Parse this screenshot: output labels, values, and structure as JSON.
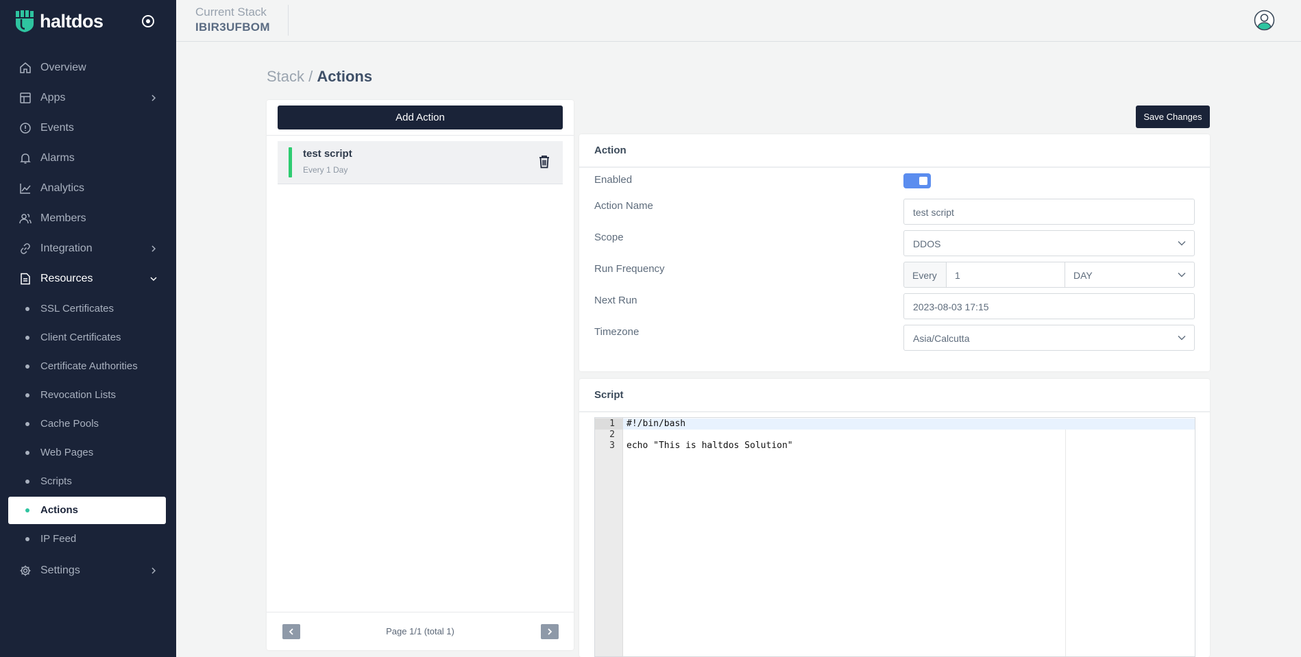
{
  "brand": {
    "name": "haltdos"
  },
  "sidebar": {
    "items": [
      {
        "label": "Overview",
        "icon": "home-icon"
      },
      {
        "label": "Apps",
        "icon": "layout-icon",
        "has_children": true
      },
      {
        "label": "Events",
        "icon": "alert-circle-icon"
      },
      {
        "label": "Alarms",
        "icon": "bell-icon"
      },
      {
        "label": "Analytics",
        "icon": "chart-line-icon"
      },
      {
        "label": "Members",
        "icon": "users-icon"
      },
      {
        "label": "Integration",
        "icon": "link-icon",
        "has_children": true
      },
      {
        "label": "Resources",
        "icon": "file-text-icon",
        "expanded": true
      },
      {
        "label": "Settings",
        "icon": "gear-icon",
        "has_children": true
      }
    ],
    "resources": [
      {
        "label": "SSL Certificates"
      },
      {
        "label": "Client Certificates"
      },
      {
        "label": "Certificate Authorities"
      },
      {
        "label": "Revocation Lists"
      },
      {
        "label": "Cache Pools"
      },
      {
        "label": "Web Pages"
      },
      {
        "label": "Scripts"
      },
      {
        "label": "Actions",
        "active": true
      },
      {
        "label": "IP Feed"
      }
    ]
  },
  "header": {
    "stack_label": "Current Stack",
    "stack_value": "IBIR3UFBOM"
  },
  "breadcrumb": {
    "parent": "Stack",
    "separator": "/",
    "current": "Actions"
  },
  "list": {
    "add_button": "Add Action",
    "items": [
      {
        "name": "test script",
        "schedule": "Every 1 Day"
      }
    ],
    "pagination": "Page 1/1 (total 1)"
  },
  "toolbar": {
    "save_label": "Save Changes"
  },
  "action_form": {
    "title": "Action",
    "enabled_label": "Enabled",
    "enabled": true,
    "name_label": "Action Name",
    "name_value": "test script",
    "scope_label": "Scope",
    "scope_value": "DDOS",
    "frequency_label": "Run Frequency",
    "frequency_prefix": "Every",
    "frequency_value": "1",
    "frequency_unit": "DAY",
    "next_run_label": "Next Run",
    "next_run_value": "2023-08-03 17:15",
    "timezone_label": "Timezone",
    "timezone_value": "Asia/Calcutta"
  },
  "script": {
    "title": "Script",
    "lines": [
      "#!/bin/bash",
      "",
      "echo \"This is haltdos Solution\""
    ],
    "line_numbers": [
      "1",
      "2",
      "3"
    ]
  },
  "colors": {
    "sidebar_bg": "#1a2338",
    "accent": "#2ec4a0",
    "toggle_on": "#5b8def",
    "status_bar": "#2ecc71"
  }
}
